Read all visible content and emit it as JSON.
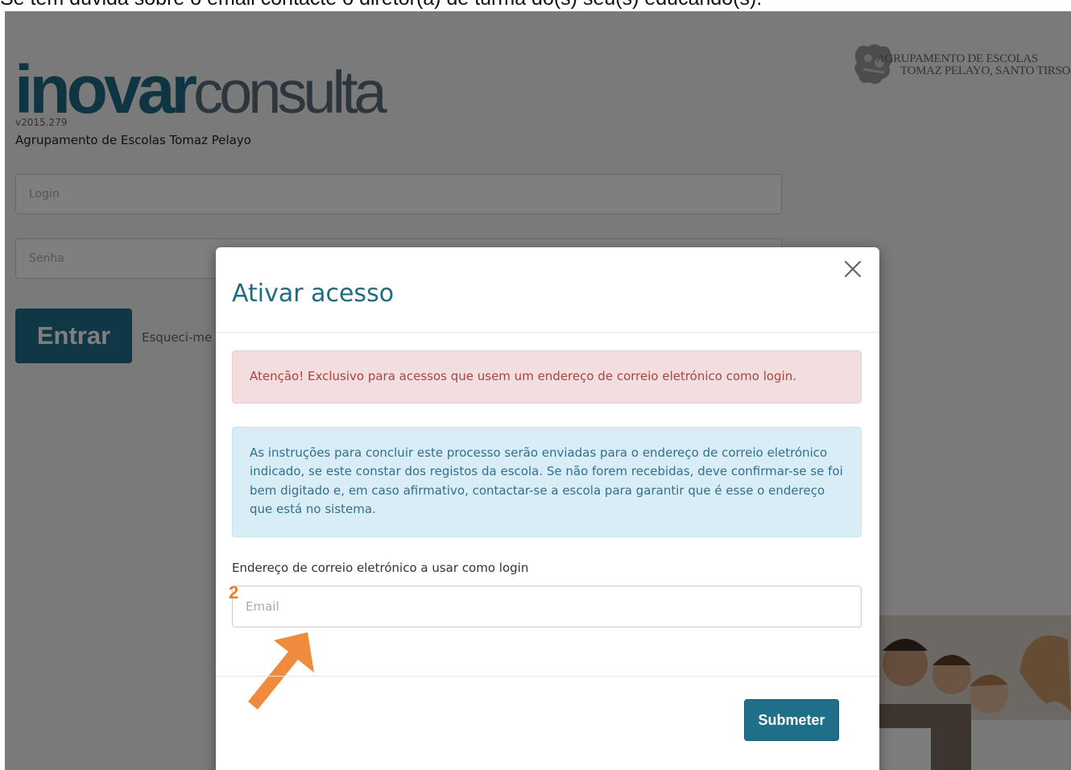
{
  "caption": "Se tem dúvida sobre o email contacte o diretor(a) de turma do(s) seu(s) educando(s).",
  "app": {
    "brand_part1": "inovar",
    "brand_part2": "consulta",
    "version": "v2015.279",
    "school_name": "Agrupamento de Escolas Tomaz Pelayo"
  },
  "school_logo": {
    "line1": "AGRUPAMENTO DE ESCOLAS",
    "line2": "TOMAZ PELAYO, SANTO TIRSO"
  },
  "login_form": {
    "login_placeholder": "Login",
    "password_placeholder": "Senha",
    "submit_label": "Entrar",
    "forgot_link": "Esqueci-me"
  },
  "modal": {
    "title": "Ativar acesso",
    "warning": "Atenção! Exclusivo para acessos que usem um endereço de correio eletrónico como login.",
    "info": "As instruções para concluir este processo serão enviadas para o endereço de correio eletrónico indicado, se este constar dos registos da escola. Se não forem recebidas, deve confirmar-se se foi bem digitado e, em caso afirmativo, contactar-se a escola para garantir que é esse o endereço que está no sistema.",
    "email_label": "Endereço de correio eletrónico a usar como login",
    "email_placeholder": "Email",
    "submit_label": "Submeter"
  },
  "annotation": {
    "step": "2",
    "color": "#e87d2a"
  },
  "colors": {
    "primary": "#1f6f8b",
    "danger_text": "#a94442",
    "danger_bg": "#f2dede",
    "info_text": "#31708f",
    "info_bg": "#d9edf7"
  }
}
